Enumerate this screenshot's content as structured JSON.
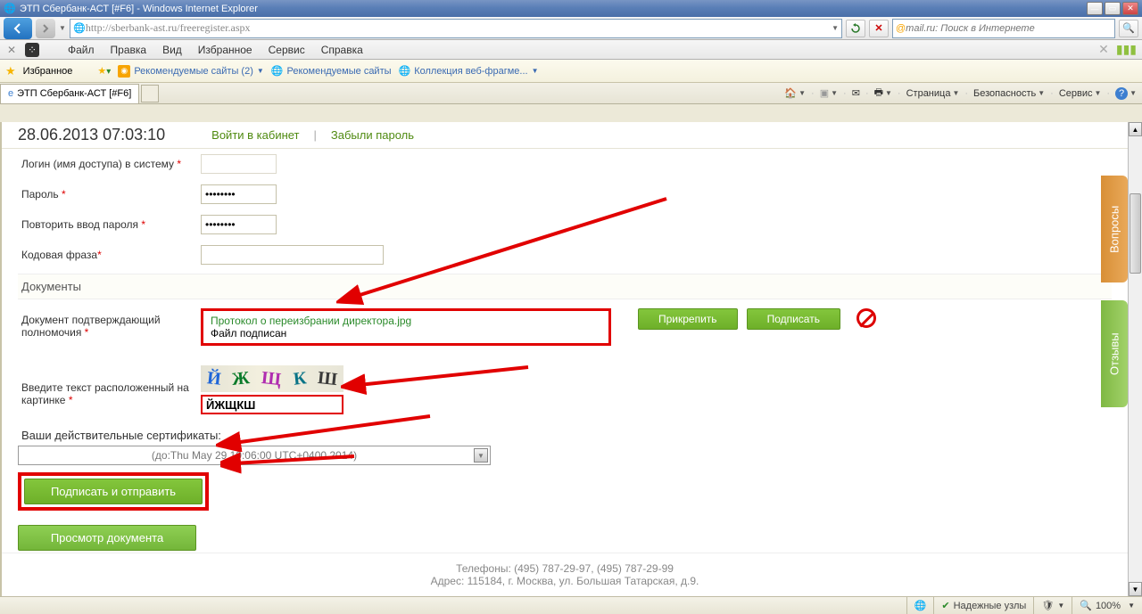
{
  "window": {
    "title": "ЭТП Сбербанк-АСТ [#F6] - Windows Internet Explorer"
  },
  "nav": {
    "url": "http://sberbank-ast.ru/freeregister.aspx"
  },
  "search": {
    "placeholder": "mail.ru: Поиск в Интернете"
  },
  "menus": {
    "file": "Файл",
    "edit": "Правка",
    "view": "Вид",
    "favorites": "Избранное",
    "tools": "Сервис",
    "help": "Справка"
  },
  "favbar": {
    "label": "Избранное",
    "rec_sites": "Рекомендуемые сайты (2)",
    "rec_sites2": "Рекомендуемые сайты",
    "webslice": "Коллекция веб-фрагме..."
  },
  "tabs": {
    "active": "ЭТП Сбербанк-АСТ [#F6]"
  },
  "cmdbar": {
    "page": "Страница",
    "safety": "Безопасность",
    "service": "Сервис"
  },
  "header": {
    "datetime": "28.06.2013 07:03:10",
    "login": "Войти в кабинет",
    "forgot": "Забыли пароль",
    "sep": "|"
  },
  "form": {
    "login_label": "Логин (имя доступа) в систему",
    "password_label": "Пароль",
    "password_value": "••••••••",
    "password2_label": "Повторить ввод пароля",
    "password2_value": "••••••••",
    "codephrase_label": "Кодовая фраза",
    "section_docs": "Документы",
    "doc_label": "Документ подтверждающий полномочия",
    "file_name": "Протокол о переизбрании директора.jpg",
    "file_status": "Файл подписан",
    "attach_btn": "Прикрепить",
    "sign_btn": "Подписать",
    "captcha_label": "Введите текст расположенный на картинке",
    "captcha_letters": [
      "Й",
      "Ж",
      "Щ",
      "К",
      "Ш"
    ],
    "captcha_colors": [
      "#1f66d8",
      "#0a7a2a",
      "#b02db0",
      "#0a7487",
      "#3a3a3a"
    ],
    "captcha_value": "ЙЖЩКШ",
    "cert_label": "Ваши действительные сертификаты:",
    "cert_value": "(до:Thu May 29 10:06:00 UTC+0400 2014)",
    "submit_btn": "Подписать и отправить",
    "preview_btn": "Просмотр документа"
  },
  "sidetabs": {
    "questions": "Вопросы",
    "reviews": "Отзывы"
  },
  "footer": {
    "phones": "Телефоны: (495) 787-29-97, (495) 787-29-99",
    "address": "Адрес: 115184, г. Москва, ул. Большая Татарская, д.9."
  },
  "status": {
    "trusted": "Надежные узлы",
    "zoom": "100%"
  }
}
